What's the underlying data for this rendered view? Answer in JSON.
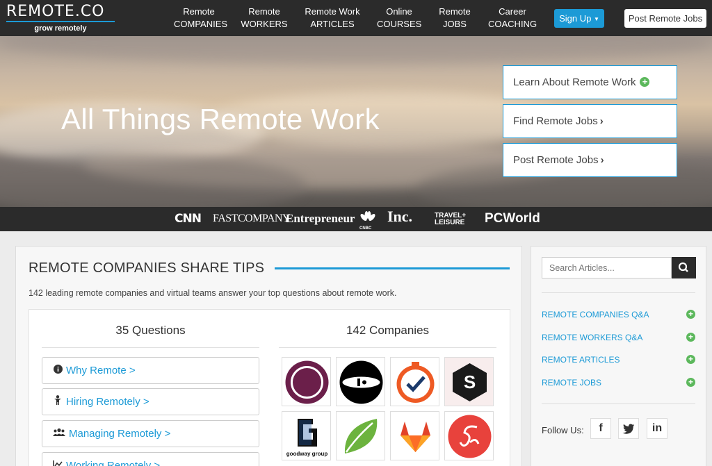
{
  "brand": {
    "name": "REMOTE.CO",
    "tagline": "grow remotely"
  },
  "nav": {
    "items": [
      {
        "line1": "Remote",
        "line2": "COMPANIES"
      },
      {
        "line1": "Remote",
        "line2": "WORKERS"
      },
      {
        "line1": "Remote Work",
        "line2": "ARTICLES"
      },
      {
        "line1": "Online",
        "line2": "COURSES"
      },
      {
        "line1": "Remote",
        "line2": "JOBS"
      },
      {
        "line1": "Career",
        "line2": "COACHING"
      }
    ],
    "signup_label": "Sign Up",
    "post_jobs_label": "Post Remote Jobs"
  },
  "hero": {
    "title": "All Things Remote Work",
    "buttons": [
      {
        "label": "Learn About Remote Work",
        "icon": "plus-circle-icon"
      },
      {
        "label": "Find Remote Jobs",
        "icon": "chevron-right-icon"
      },
      {
        "label": "Post Remote Jobs",
        "icon": "chevron-right-icon"
      }
    ]
  },
  "press": [
    "CNN",
    "FASTCOMPANY",
    "Entrepreneur",
    "CNBC",
    "Inc.",
    "TRAVEL+ LEISURE",
    "PCWorld"
  ],
  "main": {
    "title": "REMOTE COMPANIES SHARE TIPS",
    "description": "142 leading remote companies and virtual teams answer your top questions about remote work.",
    "questions_header": "35 Questions",
    "companies_header": "142 Companies",
    "questions": [
      {
        "label": "Why Remote >",
        "icon": "info-icon"
      },
      {
        "label": "Hiring Remotely >",
        "icon": "person-icon"
      },
      {
        "label": "Managing Remotely >",
        "icon": "users-icon"
      },
      {
        "label": "Working Remotely >",
        "icon": "chart-icon"
      }
    ],
    "company_logo_text": {
      "goodway": "goodway group",
      "s_logo": "S"
    }
  },
  "sidebar": {
    "search_placeholder": "Search Articles...",
    "links": [
      "REMOTE COMPANIES Q&A",
      "REMOTE WORKERS Q&A",
      "REMOTE ARTICLES",
      "REMOTE JOBS"
    ],
    "follow_label": "Follow Us:",
    "social": [
      "f",
      "twitter",
      "in"
    ]
  },
  "colors": {
    "accent": "#1c9ad6",
    "dark": "#2b2b2b",
    "green": "#5cb85c"
  }
}
